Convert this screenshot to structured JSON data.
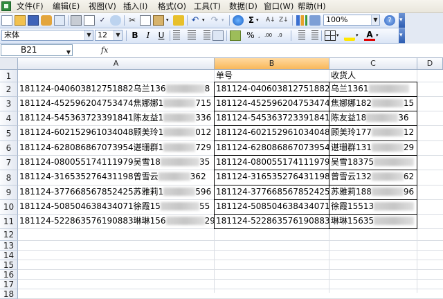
{
  "menu": [
    "文件(F)",
    "编辑(E)",
    "视图(V)",
    "插入(I)",
    "格式(O)",
    "工具(T)",
    "数据(D)",
    "窗口(W)",
    "帮助(H)"
  ],
  "toolbar": {
    "zoom": "100%",
    "sigma": "Σ",
    "font_name": "宋体",
    "font_size": "12",
    "bold": "B",
    "italic": "I",
    "underline": "U",
    "percent": "%",
    "font_color_letter": "A",
    "icons": [
      "new-icon",
      "open-icon",
      "save-icon",
      "permission-icon",
      "email-icon",
      "print-icon",
      "print-preview-icon",
      "spelling-icon",
      "research-icon",
      "cut-icon",
      "copy-icon",
      "paste-icon",
      "format-painter-icon",
      "undo-icon",
      "redo-icon",
      "hyperlink-icon",
      "autosum-icon",
      "sort-ascending-icon",
      "sort-descending-icon",
      "chart-wizard-icon",
      "drawing-icon",
      "help-icon"
    ]
  },
  "formula_bar": {
    "name_box": "B21",
    "fx": "fx",
    "formula": ""
  },
  "columns": [
    "A",
    "B",
    "C",
    "D"
  ],
  "selected_column": "B",
  "rows": [
    "1",
    "2",
    "3",
    "4",
    "5",
    "6",
    "7",
    "8",
    "9",
    "10",
    "11",
    "12",
    "13",
    "14",
    "15",
    "16",
    "17",
    "18"
  ],
  "header_row": {
    "B": "单号",
    "C": "收货人"
  },
  "cells": [
    {
      "a_prefix": "181124-040603812751882乌兰136",
      "a_suffix": "8",
      "b": "181124-040603812751882",
      "c_prefix": "乌兰1361",
      "c_suffix": ""
    },
    {
      "a_prefix": "181124-452596204753474焦娜娜1",
      "a_suffix": "715",
      "b": "181124-452596204753474",
      "c_prefix": "焦娜娜182",
      "c_suffix": "15"
    },
    {
      "a_prefix": "181124-545363723391841陈友益1",
      "a_suffix": "336",
      "b": "181124-545363723391841",
      "c_prefix": "陈友益18",
      "c_suffix": "36"
    },
    {
      "a_prefix": "181124-602152961034048顾美玲1",
      "a_suffix": "012",
      "b": "181124-602152961034048",
      "c_prefix": "顾美玲177",
      "c_suffix": "12"
    },
    {
      "a_prefix": "181124-628086867073954谌珊群1",
      "a_suffix": "729",
      "b": "181124-628086867073954",
      "c_prefix": "谌珊群131",
      "c_suffix": "29"
    },
    {
      "a_prefix": "181124-080055174111979吴雪18",
      "a_suffix": "35",
      "b": "181124-080055174111979",
      "c_prefix": "吴雪18375",
      "c_suffix": ""
    },
    {
      "a_prefix": "181124-316535276431198曾雪云",
      "a_suffix": "362",
      "b": "181124-316535276431198",
      "c_prefix": "曾雪云132",
      "c_suffix": "62"
    },
    {
      "a_prefix": "181124-377668567852425苏雅莉1",
      "a_suffix": "596",
      "b": "181124-377668567852425",
      "c_prefix": "苏雅莉188",
      "c_suffix": "96"
    },
    {
      "a_prefix": "181124-508504638434071徐霞15",
      "a_suffix": "55",
      "b": "181124-508504638434071",
      "c_prefix": "徐霞15513",
      "c_suffix": ""
    },
    {
      "a_prefix": "181124-522863576190883琳琳156",
      "a_suffix": "29",
      "b": "181124-522863576190883",
      "c_prefix": "琳琳15635",
      "c_suffix": ""
    }
  ],
  "colors": {
    "selected_header": "#f8b759",
    "toolbar": "#dbe6f6",
    "gridline": "#d9dde3"
  }
}
